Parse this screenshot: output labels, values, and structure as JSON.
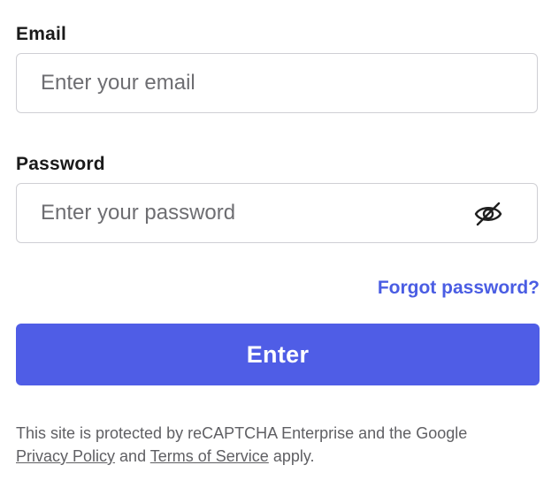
{
  "email": {
    "label": "Email",
    "placeholder": "Enter your email",
    "value": ""
  },
  "password": {
    "label": "Password",
    "placeholder": "Enter your password",
    "value": "",
    "toggle_icon": "eye-slash-icon"
  },
  "forgot_password": {
    "label": "Forgot password?"
  },
  "submit": {
    "label": "Enter"
  },
  "legal": {
    "line1": "This site is protected by reCAPTCHA Enterprise and the Google",
    "privacy_link": "Privacy Policy",
    "and": "and",
    "terms_link": "Terms of Service",
    "apply": "apply."
  },
  "colors": {
    "accent": "#4f5de6",
    "link": "#4a5de3",
    "border": "#cfcfd4",
    "muted_text": "#5f5f63"
  }
}
